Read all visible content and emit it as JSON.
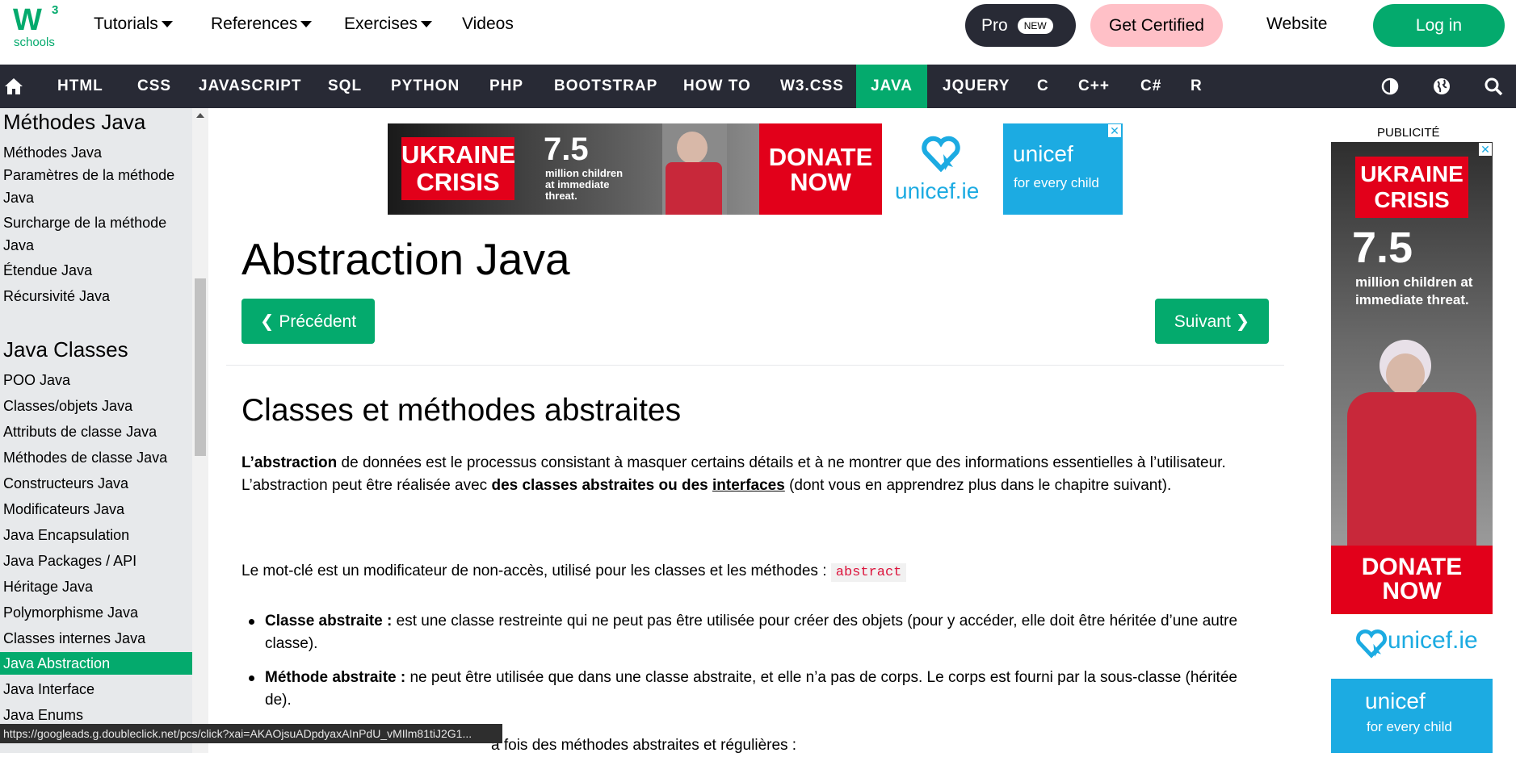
{
  "logo": {
    "w": "W",
    "sup": "3",
    "text": "schools"
  },
  "topnav": {
    "tutorials": "Tutorials",
    "references": "References",
    "exercises": "Exercises",
    "videos": "Videos",
    "pro": "Pro",
    "pro_badge": "NEW",
    "get_certified": "Get Certified",
    "website": "Website",
    "login": "Log in"
  },
  "mainnav": {
    "items": [
      "HTML",
      "CSS",
      "JAVASCRIPT",
      "SQL",
      "PYTHON",
      "PHP",
      "BOOTSTRAP",
      "HOW TO",
      "W3.CSS",
      "JAVA",
      "JQUERY",
      "C",
      "C++",
      "C#",
      "R"
    ],
    "active": "JAVA"
  },
  "sidebar": {
    "section1": "Méthodes Java",
    "links1": [
      "Méthodes Java",
      "Paramètres de la méthode",
      "Java",
      "Surcharge de la méthode",
      "Java",
      "Étendue Java",
      "Récursivité Java"
    ],
    "section2": "Java Classes",
    "links2": [
      "POO Java",
      "Classes/objets Java",
      "Attributs de classe Java",
      "Méthodes de classe Java",
      "Constructeurs Java",
      "Modificateurs Java",
      "Java Encapsulation",
      "Java Packages / API",
      "Héritage Java",
      "Polymorphisme Java",
      "Classes internes Java",
      "Java Abstraction",
      "Java Interface",
      "Java Enums"
    ],
    "active": "Java Abstraction"
  },
  "ad_top": {
    "crisis": "UKRAINE CRISIS",
    "number": "7.5",
    "caption": "million children at immediate threat.",
    "donate": "DONATE NOW",
    "site": "unicef.ie",
    "brand": "unicef",
    "tagline": "for every child"
  },
  "main": {
    "title": "Abstraction Java",
    "prev": "❮ Précédent",
    "next": "Suivant ❯",
    "subtitle": "Classes et méthodes abstraites",
    "p1_bold": "L’abstraction",
    "p1_rest": " de données est le processus consistant à masquer certains détails et à ne montrer que des informations essentielles à l’utilisateur.",
    "p2_start": "L’abstraction peut être réalisée avec ",
    "p2_bold": "des classes abstraites ou des ",
    "p2_link": "interfaces",
    "p2_end": " (dont vous en apprendrez plus dans le chapitre suivant).",
    "p3": "Le mot-clé est un modificateur de non-accès, utilisé pour les classes et les méthodes : ",
    "p3_code": "abstract",
    "b1_bold": "Classe abstraite :",
    "b1_rest": " est une classe restreinte qui ne peut pas être utilisée pour créer des objets (pour y accéder, elle doit être héritée d’une autre classe).",
    "b2_bold": "Méthode abstraite :",
    "b2_rest": " ne peut être utilisée que dans une classe abstraite, et elle n’a pas de corps. Le corps est fourni par la sous-classe (héritée de).",
    "p4_partial": "a fois des méthodes abstraites et régulières :"
  },
  "side_ad": {
    "label": "PUBLICITÉ",
    "crisis": "UKRAINE CRISIS",
    "number": "7.5",
    "caption": "million children at immediate threat.",
    "donate": "DONATE NOW",
    "site": "unicef.ie",
    "brand": "unicef",
    "tagline": "for every child"
  },
  "statusbar": {
    "url": "https://googleads.g.doubleclick.net/pcs/click?xai=AKAOjsuADpdyaxAInPdU_vMIlm81tiJ2G1..."
  },
  "colors": {
    "accent": "#04aa6d",
    "nav_bg": "#282a35",
    "sidebar_bg": "#e7e9eb",
    "cert_bg": "#ffc0c7"
  }
}
